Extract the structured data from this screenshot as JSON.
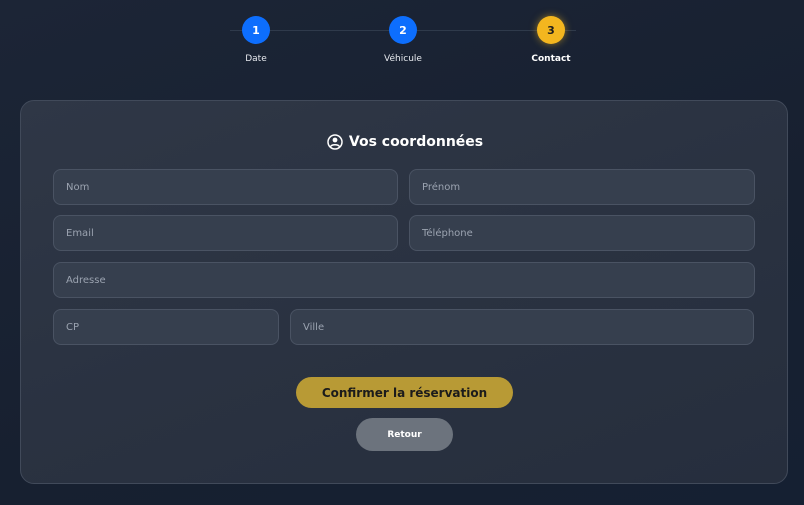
{
  "stepper": {
    "steps": [
      {
        "number": "1",
        "label": "Date",
        "state": "done"
      },
      {
        "number": "2",
        "label": "Véhicule",
        "state": "done"
      },
      {
        "number": "3",
        "label": "Contact",
        "state": "active"
      }
    ]
  },
  "form": {
    "title": "Vos coordonnées",
    "title_icon": "user-circle-icon",
    "fields": {
      "nom": {
        "placeholder": "Nom",
        "value": ""
      },
      "prenom": {
        "placeholder": "Prénom",
        "value": ""
      },
      "email": {
        "placeholder": "Email",
        "value": ""
      },
      "telephone": {
        "placeholder": "Téléphone",
        "value": ""
      },
      "adresse": {
        "placeholder": "Adresse",
        "value": ""
      },
      "cp": {
        "placeholder": "CP",
        "value": ""
      },
      "ville": {
        "placeholder": "Ville",
        "value": ""
      }
    },
    "confirm_label": "Confirmer la réservation",
    "back_label": "Retour"
  },
  "colors": {
    "step_done": "#0d6efd",
    "step_active": "#f3b61f",
    "confirm_button": "#b89a35",
    "back_button": "#6c737d"
  }
}
